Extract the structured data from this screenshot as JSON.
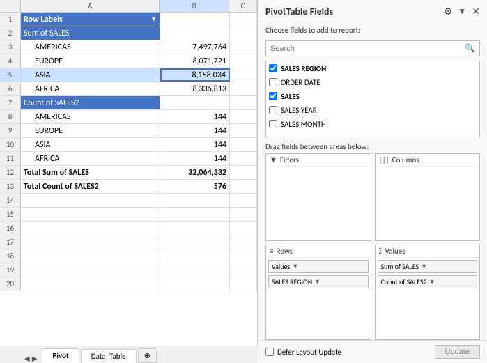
{
  "spreadsheet": {
    "col_headers": [
      "",
      "A",
      "B",
      "C"
    ],
    "rows": [
      {
        "num": "1",
        "a": "Row Labels",
        "b": "",
        "c": "",
        "style": "header"
      },
      {
        "num": "2",
        "a": "Sum of SALES",
        "b": "",
        "c": "",
        "style": "group"
      },
      {
        "num": "3",
        "a": "AMERICAS",
        "b": "7,497,764",
        "c": "",
        "style": "indent"
      },
      {
        "num": "4",
        "a": "EUROPE",
        "b": "8,071,721",
        "c": "",
        "style": "indent"
      },
      {
        "num": "5",
        "a": "ASIA",
        "b": "8,158,034",
        "c": "",
        "style": "selected-indent"
      },
      {
        "num": "6",
        "a": "AFRICA",
        "b": "8,336,813",
        "c": "",
        "style": "indent"
      },
      {
        "num": "7",
        "a": "Count of SALES2",
        "b": "",
        "c": "",
        "style": "group"
      },
      {
        "num": "8",
        "a": "AMERICAS",
        "b": "144",
        "c": "",
        "style": "indent"
      },
      {
        "num": "9",
        "a": "EUROPE",
        "b": "144",
        "c": "",
        "style": "indent"
      },
      {
        "num": "10",
        "a": "ASIA",
        "b": "144",
        "c": "",
        "style": "indent"
      },
      {
        "num": "11",
        "a": "AFRICA",
        "b": "144",
        "c": "",
        "style": "indent"
      },
      {
        "num": "12",
        "a": "Total Sum of SALES",
        "b": "32,064,332",
        "c": "",
        "style": "total"
      },
      {
        "num": "13",
        "a": "Total Count of SALES2",
        "b": "576",
        "c": "",
        "style": "total"
      },
      {
        "num": "14",
        "a": "",
        "b": "",
        "c": "",
        "style": "empty"
      },
      {
        "num": "15",
        "a": "",
        "b": "",
        "c": "",
        "style": "empty"
      },
      {
        "num": "16",
        "a": "",
        "b": "",
        "c": "",
        "style": "empty"
      },
      {
        "num": "17",
        "a": "",
        "b": "",
        "c": "",
        "style": "empty"
      },
      {
        "num": "18",
        "a": "",
        "b": "",
        "c": "",
        "style": "empty"
      },
      {
        "num": "19",
        "a": "",
        "b": "",
        "c": "",
        "style": "empty"
      },
      {
        "num": "20",
        "a": "",
        "b": "",
        "c": "",
        "style": "empty"
      }
    ],
    "tabs": [
      "Pivot",
      "Data_Table"
    ],
    "active_tab": "Pivot"
  },
  "pivot_panel": {
    "title": "PivotTable Fields",
    "subtitle": "Choose fields to add to report:",
    "search_placeholder": "Search",
    "fields": [
      {
        "name": "SALES REGION",
        "checked": true
      },
      {
        "name": "ORDER DATE",
        "checked": false
      },
      {
        "name": "SALES",
        "checked": true
      },
      {
        "name": "SALES YEAR",
        "checked": false
      },
      {
        "name": "SALES MONTH",
        "checked": false
      }
    ],
    "drag_label": "Drag fields between areas below:",
    "areas": {
      "filters": {
        "label": "Filters",
        "icon": "▼"
      },
      "columns": {
        "label": "Columns",
        "icon": "|||"
      },
      "rows": {
        "label": "Rows",
        "icon": "≡",
        "items": [
          "Values",
          "SALES REGION"
        ]
      },
      "values": {
        "label": "Values",
        "icon": "Σ",
        "items": [
          "Sum of SALES",
          "Count of SALES2"
        ]
      }
    },
    "defer_label": "Defer Layout Update",
    "update_label": "Update"
  }
}
